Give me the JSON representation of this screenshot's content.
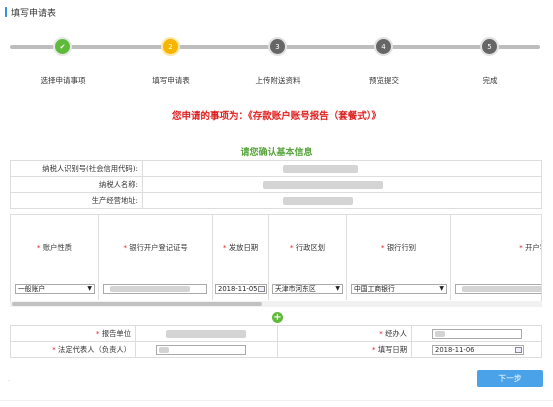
{
  "header": {
    "title": "填写申请表"
  },
  "steps": [
    {
      "num": "✔",
      "label": "选择申请事项",
      "state": "done"
    },
    {
      "num": "2",
      "label": "填写申请表",
      "state": "current"
    },
    {
      "num": "3",
      "label": "上传附送资料",
      "state": "todo"
    },
    {
      "num": "4",
      "label": "预览提交",
      "state": "todo"
    },
    {
      "num": "5",
      "label": "完成",
      "state": "todo"
    }
  ],
  "notice": "您申请的事项为：《存款账户账号报告（套餐式）》",
  "section_title": "请您确认基本信息",
  "basic_info": {
    "tax_id_label": "纳税人识别号(社会信用代码):",
    "name_label": "纳税人名称:",
    "address_label": "生产经营地址:"
  },
  "grid": {
    "columns": [
      "账户性质",
      "银行开户登记证号",
      "发放日期",
      "行政区划",
      "银行行别",
      "开户银"
    ],
    "row": {
      "account_type": "一般账户",
      "issue_date": "2018-11-05",
      "district": "天津市河东区",
      "bank_type": "中国工商银行"
    }
  },
  "bottom": {
    "report_unit_label": "报告单位",
    "handler_label": "经办人",
    "legal_rep_label": "法定代表人（负责人）",
    "fill_date_label": "填写日期",
    "fill_date_value": "2018-11-06"
  },
  "next_button": "下一步",
  "colors": {
    "accent": "#4aa3e8",
    "done": "#5fba3b",
    "current": "#f7b500",
    "required": "#e02020"
  }
}
